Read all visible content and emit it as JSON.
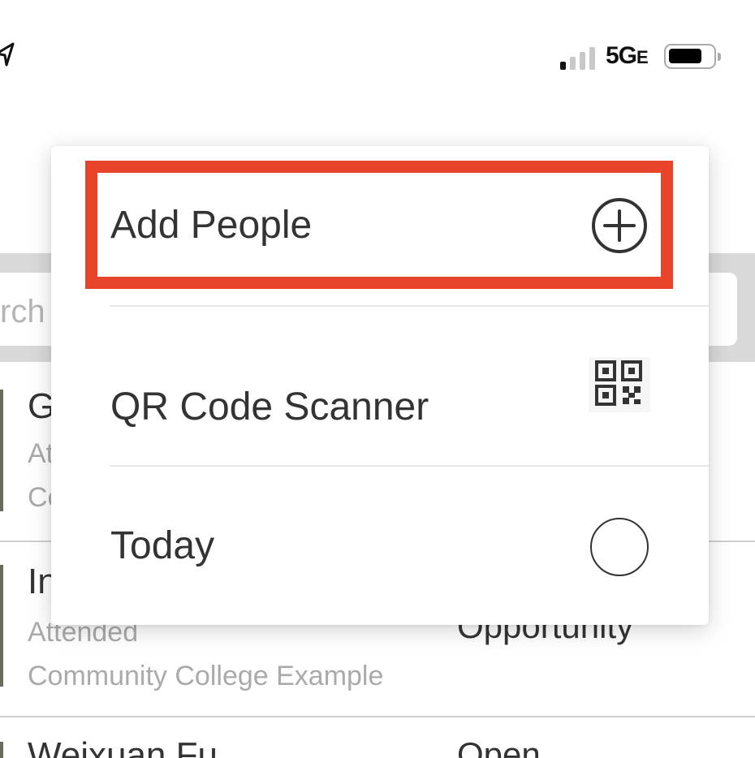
{
  "status_bar": {
    "network": "5G",
    "network_suffix": "E"
  },
  "search": {
    "placeholder_fragment": "rch"
  },
  "list": [
    {
      "name": "G",
      "line1": "At",
      "line2": "Co",
      "status": ""
    },
    {
      "name": "In",
      "line1": "Attended",
      "line2": "Community College Example",
      "status": "Opportunity"
    },
    {
      "name": "Weixuan Fu",
      "line1": "",
      "line2": "",
      "status": "Open"
    }
  ],
  "menu": {
    "items": [
      {
        "label": "Add People",
        "icon": "plus-circle-icon"
      },
      {
        "label": "QR Code Scanner",
        "icon": "qr-code-icon"
      },
      {
        "label": "Today",
        "icon": "empty-circle-icon"
      }
    ],
    "highlight_color": "#e8432b"
  }
}
